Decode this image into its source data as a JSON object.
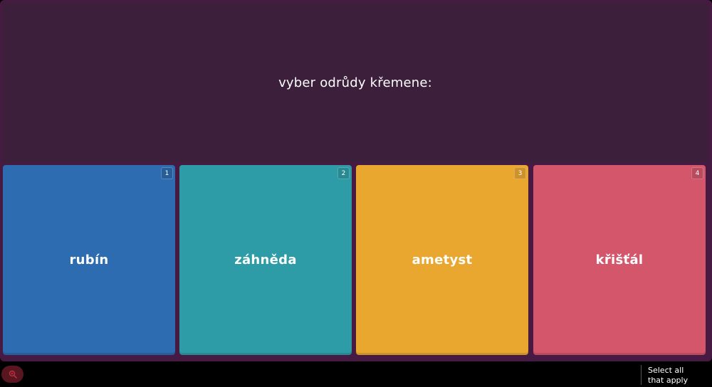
{
  "question": {
    "text": "vyber odrůdy křemene:"
  },
  "options": [
    {
      "number": "1",
      "label": "rubín",
      "color": "#2d6cb0"
    },
    {
      "number": "2",
      "label": "záhněda",
      "color": "#2d9ca6"
    },
    {
      "number": "3",
      "label": "ametyst",
      "color": "#eaa72f"
    },
    {
      "number": "4",
      "label": "křišťál",
      "color": "#d4566b"
    }
  ],
  "footer": {
    "zoom_icon": "zoom-in-icon",
    "hint_line1": "Select all",
    "hint_line2": "that apply"
  },
  "colors": {
    "frame": "#461a42",
    "question_bg": "#3b1f3b"
  }
}
